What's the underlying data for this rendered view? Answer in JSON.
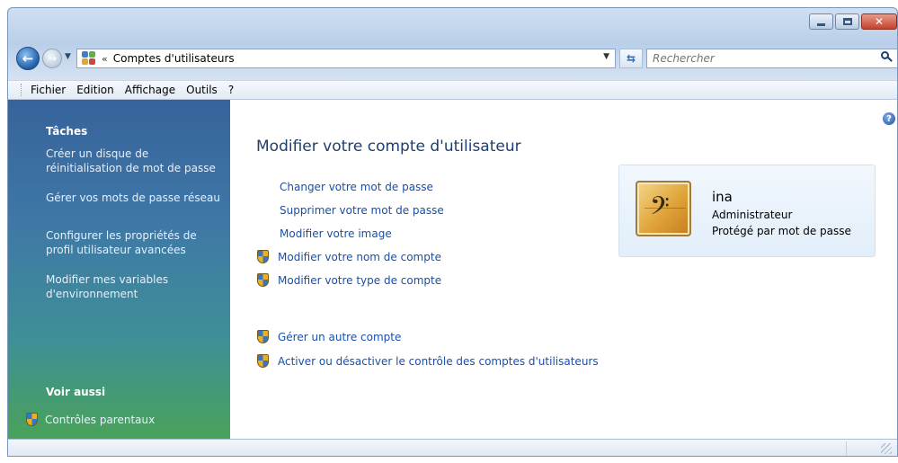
{
  "window": {
    "controls": [
      "minimize",
      "maximize",
      "close"
    ]
  },
  "nav": {
    "address_chevron": "«",
    "address_crumb": "Comptes d'utilisateurs",
    "search_placeholder": "Rechercher",
    "icons": {
      "back": "back-arrow-icon",
      "forward": "forward-arrow-icon",
      "refresh": "refresh-icon",
      "search": "search-icon"
    }
  },
  "menubar": {
    "items": [
      "Fichier",
      "Edition",
      "Affichage",
      "Outils",
      "?"
    ]
  },
  "sidebar": {
    "tasks_heading": "Tâches",
    "tasks": [
      [
        "Créer un disque de",
        "réinitialisation de mot de passe"
      ],
      [
        "Gérer vos mots de passe réseau"
      ],
      [
        "Configurer les propriétés de",
        "profil utilisateur avancées"
      ],
      [
        "Modifier mes variables",
        "d'environnement"
      ]
    ],
    "see_also_heading": "Voir aussi",
    "see_also": [
      "Contrôles parentaux"
    ]
  },
  "main": {
    "title": "Modifier votre compte d'utilisateur",
    "links": [
      {
        "label": "Changer votre mot de passe",
        "shield": false
      },
      {
        "label": "Supprimer votre mot de passe",
        "shield": false
      },
      {
        "label": "Modifier votre image",
        "shield": false
      },
      {
        "label": "Modifier votre nom de compte",
        "shield": true
      },
      {
        "label": "Modifier votre type de compte",
        "shield": true
      }
    ],
    "links2": [
      {
        "label": "Gérer un autre compte",
        "shield": true
      },
      {
        "label": "Activer ou désactiver le contrôle des comptes d'utilisateurs",
        "shield": true
      }
    ],
    "help": "?"
  },
  "user": {
    "name": "ina",
    "role": "Administrateur",
    "protection": "Protégé par mot de passe",
    "avatar_icon": "bass-clef-icon",
    "avatar_glyph": "𝄢"
  },
  "colors": {
    "link": "#1a4fa8",
    "sidebar_top": "#36639b",
    "sidebar_bottom": "#49a25a",
    "title": "#1e3f6e"
  }
}
